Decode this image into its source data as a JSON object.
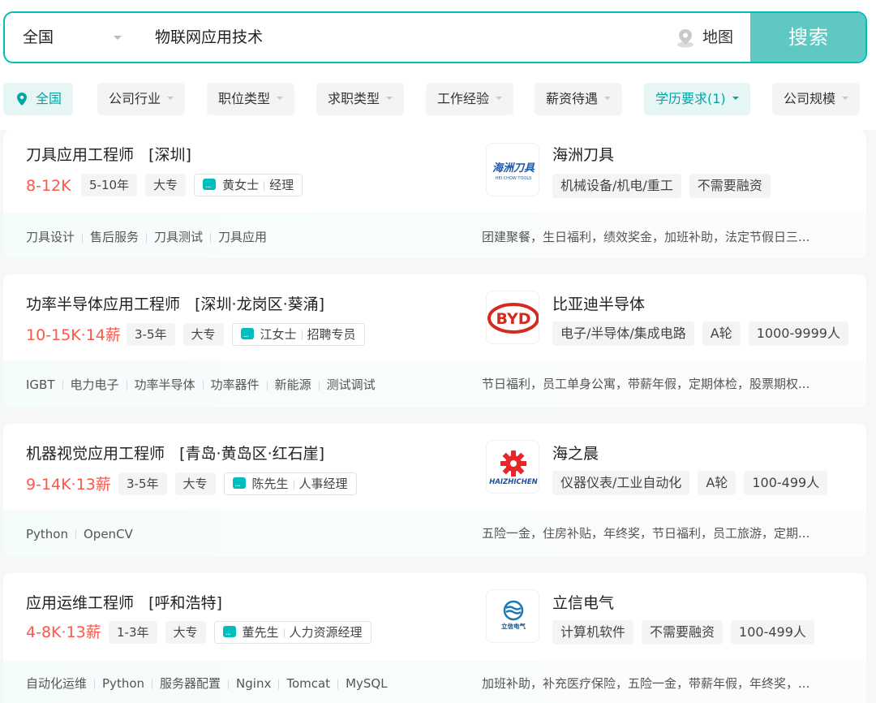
{
  "search": {
    "city": "全国",
    "query": "物联网应用技术",
    "map_label": "地图",
    "button_label": "搜索"
  },
  "filters": [
    {
      "label": "全国"
    },
    {
      "label": "公司行业"
    },
    {
      "label": "职位类型"
    },
    {
      "label": "求职类型"
    },
    {
      "label": "工作经验"
    },
    {
      "label": "薪资待遇"
    },
    {
      "label": "学历要求(1)"
    },
    {
      "label": "公司规模"
    }
  ],
  "jobs": [
    {
      "title": "刀具应用工程师",
      "location": "[深圳]",
      "salary": "8-12K",
      "experience": "5-10年",
      "degree": "大专",
      "recruiter_name": "黄女士",
      "recruiter_title": "经理",
      "company": "海洲刀具",
      "logo_text": "海洲刀具",
      "logo_sub": "HEI CHOW TOOLS",
      "company_tags": [
        "机械设备/机电/重工",
        "不需要融资"
      ],
      "skills": [
        "刀具设计",
        "售后服务",
        "刀具测试",
        "刀具应用"
      ],
      "welfare": "团建聚餐，生日福利，绩效奖金，加班补助，法定节假日三..."
    },
    {
      "title": "功率半导体应用工程师",
      "location": "[深圳·龙岗区·葵涌]",
      "salary": "10-15K·14薪",
      "experience": "3-5年",
      "degree": "大专",
      "recruiter_name": "江女士",
      "recruiter_title": "招聘专员",
      "company": "比亚迪半导体",
      "logo_text": "BYD",
      "logo_sub": "",
      "company_tags": [
        "电子/半导体/集成电路",
        "A轮",
        "1000-9999人"
      ],
      "skills": [
        "IGBT",
        "电力电子",
        "功率半导体",
        "功率器件",
        "新能源",
        "测试调试"
      ],
      "welfare": "节日福利，员工单身公寓，带薪年假，定期体检，股票期权..."
    },
    {
      "title": "机器视觉应用工程师",
      "location": "[青岛·黄岛区·红石崖]",
      "salary": "9-14K·13薪",
      "experience": "3-5年",
      "degree": "大专",
      "recruiter_name": "陈先生",
      "recruiter_title": "人事经理",
      "company": "海之晨",
      "logo_text": "HAIZHICHEN",
      "logo_sub": "",
      "company_tags": [
        "仪器仪表/工业自动化",
        "A轮",
        "100-499人"
      ],
      "skills": [
        "Python",
        "OpenCV"
      ],
      "welfare": "五险一金，住房补贴，年终奖，节日福利，员工旅游，定期..."
    },
    {
      "title": "应用运维工程师",
      "location": "[呼和浩特]",
      "salary": "4-8K·13薪",
      "experience": "1-3年",
      "degree": "大专",
      "recruiter_name": "董先生",
      "recruiter_title": "人力资源经理",
      "company": "立信电气",
      "logo_text": "立信电气",
      "logo_sub": "",
      "company_tags": [
        "计算机软件",
        "不需要融资",
        "100-499人"
      ],
      "skills": [
        "自动化运维",
        "Python",
        "服务器配置",
        "Nginx",
        "Tomcat",
        "MySQL"
      ],
      "welfare": "加班补助，补充医疗保险，五险一金，带薪年假，年终奖，..."
    }
  ],
  "colors": {
    "accent": "#00bebd",
    "search_button": "#5fc8c2",
    "salary": "#fe574a",
    "byd_red": "#d52b1e",
    "haizhichen_red": "#e8252b",
    "haizhichen_blue": "#1d4f9c",
    "lixin_blue": "#1a78b4"
  }
}
